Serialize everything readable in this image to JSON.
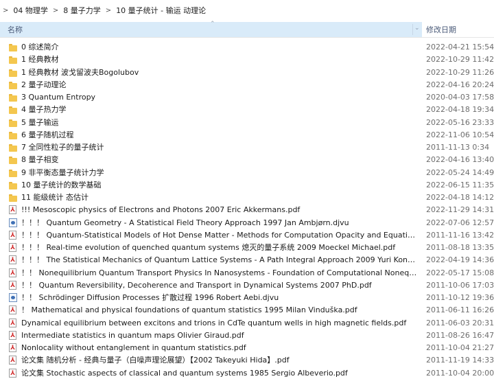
{
  "breadcrumb": {
    "items": [
      "04 物理学",
      "8 量子力学",
      "10 量子统计 - 输运 动理论"
    ]
  },
  "columns": {
    "name": "名称",
    "date": "修改日期"
  },
  "files": [
    {
      "name": "0 综述简介",
      "date": "2022-04-21 15:54",
      "type": "folder"
    },
    {
      "name": "1 经典教材",
      "date": "2022-10-29 11:42",
      "type": "folder"
    },
    {
      "name": "1 经典教材 波戈留波夫Bogolubov",
      "date": "2022-10-29 11:26",
      "type": "folder"
    },
    {
      "name": "2 量子动理论",
      "date": "2022-04-16 20:24",
      "type": "folder"
    },
    {
      "name": "3 Quantum Entropy",
      "date": "2020-04-03 17:58",
      "type": "folder"
    },
    {
      "name": "4 量子热力学",
      "date": "2022-04-18 19:34",
      "type": "folder"
    },
    {
      "name": "5 量子输运",
      "date": "2022-05-16 23:33",
      "type": "folder"
    },
    {
      "name": "6 量子随机过程",
      "date": "2022-11-06 10:54",
      "type": "folder"
    },
    {
      "name": "7 全同性粒子的量子统计",
      "date": "2011-11-13 0:34",
      "type": "folder"
    },
    {
      "name": "8 量子相变",
      "date": "2022-04-16 13:40",
      "type": "folder"
    },
    {
      "name": "9 非平衡态量子统计力学",
      "date": "2022-05-24 14:49",
      "type": "folder"
    },
    {
      "name": "10 量子统计的数学基础",
      "date": "2022-06-15 11:35",
      "type": "folder"
    },
    {
      "name": "11 能级统计 态估计",
      "date": "2022-04-18 14:12",
      "type": "folder"
    },
    {
      "name": "!!! Mesoscopic physics of Electrons and Photons  2007 Eric Akkermans.pdf",
      "date": "2022-11-29 14:31",
      "type": "pdf"
    },
    {
      "name": "！！！ Quantum Geometry - A Statistical Field Theory Approach  1997 Jan Ambjørn.djvu",
      "date": "2022-07-06 12:57",
      "type": "djvu"
    },
    {
      "name": "！！！ Quantum-Statistical Models of Hot Dense Matter - Methods for Computation Opacity and Equation of State ...",
      "date": "2011-11-16 13:42",
      "type": "pdf"
    },
    {
      "name": "！！！ Real-time evolution of quenched quantum systems 熄灭的量子系统   2009 Moeckel Michael.pdf",
      "date": "2011-08-18 13:35",
      "type": "pdf"
    },
    {
      "name": "！！！ The Statistical Mechanics of Quantum Lattice Systems - A Path Integral Approach  2009 Yuri Kondratiev.pdf",
      "date": "2022-04-19 14:36",
      "type": "pdf"
    },
    {
      "name": "！！ Nonequilibrium Quantum Transport Physics In Nanosystems - Foundation of Computational Nonequilibrium Ph...",
      "date": "2022-05-17 15:08",
      "type": "pdf"
    },
    {
      "name": "！！ Quantum Reversibility, Decoherence and Transport in Dynamical Systems  2007 PhD.pdf",
      "date": "2011-10-06 17:03",
      "type": "pdf"
    },
    {
      "name": "！！ Schrödinger Diffusion Processes 扩散过程   1996 Robert Aebi.djvu",
      "date": "2011-10-12 19:36",
      "type": "djvu"
    },
    {
      "name": "！ Mathematical and physical foundations of quantum statistics  1995 Milan Vinduška.pdf",
      "date": "2011-06-11 16:26",
      "type": "pdf"
    },
    {
      "name": "Dynamical equilibrium between excitons and trions in CdTe quantum wells in high magnetic fields.pdf",
      "date": "2011-06-03 20:31",
      "type": "pdf"
    },
    {
      "name": "Intermediate statistics in quantum maps   Olivier Giraud.pdf",
      "date": "2011-08-26 16:47",
      "type": "pdf"
    },
    {
      "name": "Nonlocality without entanglement in quantum statistics.pdf",
      "date": "2011-10-04 21:27",
      "type": "pdf"
    },
    {
      "name": "论文集   随机分析 - 经典与量子（白噪声理论展望）【2002 Takeyuki Hida】.pdf",
      "date": "2011-11-19 14:33",
      "type": "pdf"
    },
    {
      "name": "论文集 Stochastic aspects of classical and quantum systems   1985 Sergio Albeverio.pdf",
      "date": "2011-10-04 20:00",
      "type": "pdf"
    }
  ]
}
